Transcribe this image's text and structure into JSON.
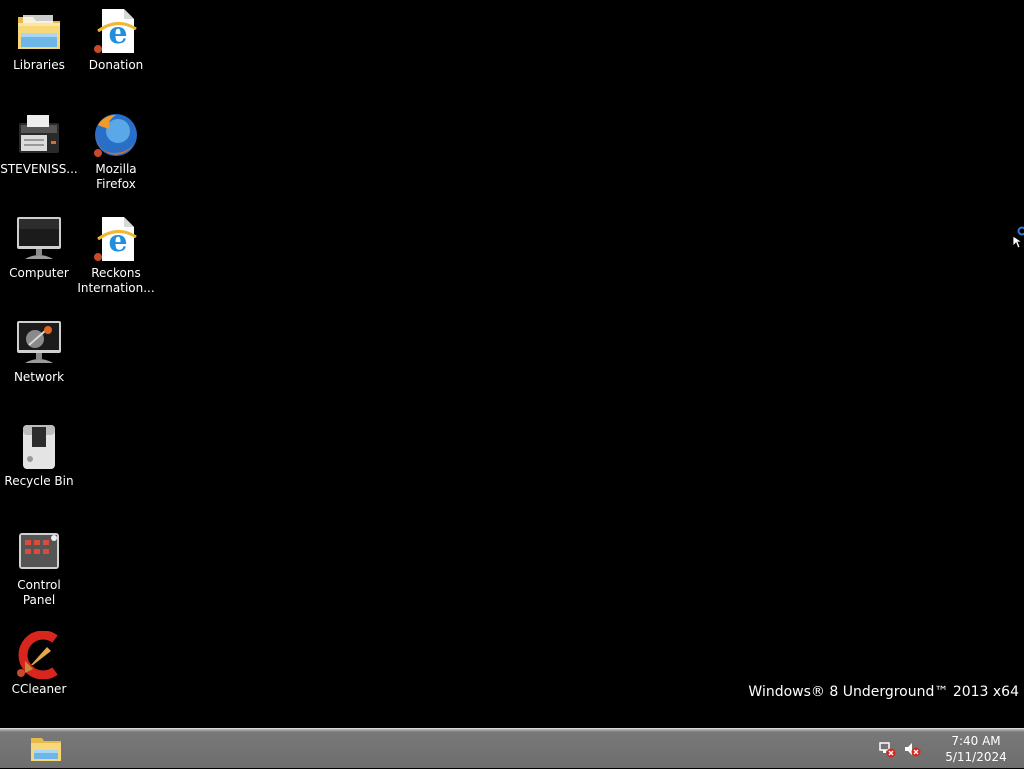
{
  "desktop": {
    "icons": [
      {
        "label": "Libraries",
        "icon": "libraries-folder-icon"
      },
      {
        "label": "Donation",
        "icon": "internet-explorer-shortcut-icon"
      },
      {
        "label": "STEVENISS...",
        "icon": "printer-icon"
      },
      {
        "label": "Mozilla Firefox",
        "icon": "firefox-shortcut-icon"
      },
      {
        "label": "Computer",
        "icon": "computer-monitor-icon"
      },
      {
        "label": "Reckons Internation...",
        "icon": "internet-explorer-shortcut-icon"
      },
      {
        "label": "Network",
        "icon": "network-icon"
      },
      {
        "label": "Recycle Bin",
        "icon": "recycle-bin-icon"
      },
      {
        "label": "Control Panel",
        "icon": "control-panel-icon"
      },
      {
        "label": "CCleaner",
        "icon": "ccleaner-shortcut-icon"
      }
    ],
    "watermark": "Windows® 8 Underground™ 2013 x64",
    "background_color": "#000000"
  },
  "taskbar": {
    "pinned": [
      {
        "icon": "file-explorer-icon"
      }
    ],
    "tray": {
      "icons": [
        "network-disconnected-icon",
        "volume-muted-icon"
      ],
      "time": "7:40 AM",
      "date": "5/11/2024"
    }
  }
}
